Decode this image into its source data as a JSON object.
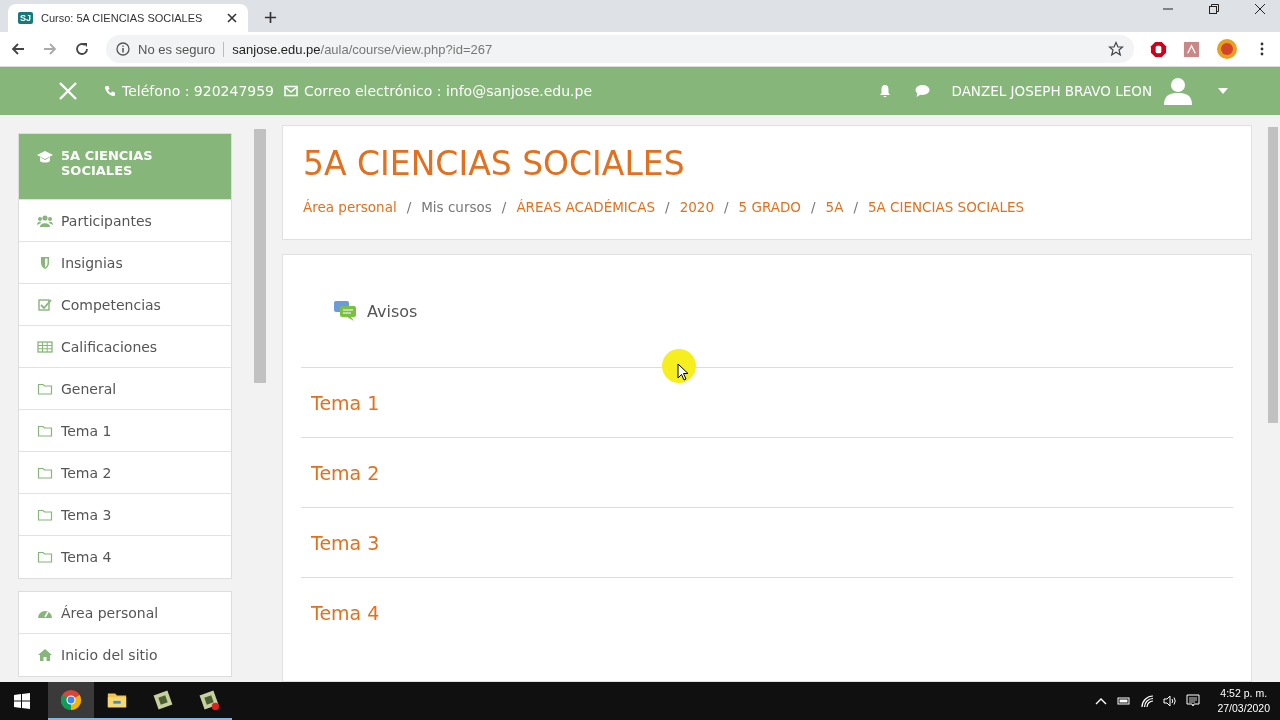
{
  "browser": {
    "tab_title": "Curso: 5A CIENCIAS SOCIALES",
    "tab_badge": "SJ",
    "security": "No es seguro",
    "url_host": "sanjose.edu.pe",
    "url_path": "/aula/course/view.php?id=267"
  },
  "header": {
    "phone": "Teléfono : 920247959",
    "email": "Correo electrónico : info@sanjose.edu.pe",
    "user_name": "DANZEL JOSEPH BRAVO LEON"
  },
  "sidebar": {
    "groups": [
      [
        {
          "label": "5A CIENCIAS SOCIALES",
          "selected": true
        },
        {
          "label": "Participantes",
          "selected": false
        },
        {
          "label": "Insignias",
          "selected": false
        },
        {
          "label": "Competencias",
          "selected": false
        },
        {
          "label": "Calificaciones",
          "selected": false
        },
        {
          "label": "General",
          "selected": false
        },
        {
          "label": "Tema 1",
          "selected": false
        },
        {
          "label": "Tema 2",
          "selected": false
        },
        {
          "label": "Tema 3",
          "selected": false
        },
        {
          "label": "Tema 4",
          "selected": false
        }
      ],
      [
        {
          "label": "Área personal",
          "selected": false
        },
        {
          "label": "Inicio del sitio",
          "selected": false
        }
      ]
    ]
  },
  "course": {
    "title": "5A CIENCIAS SOCIALES",
    "breadcrumb": [
      {
        "kind": "link",
        "label": "Área personal"
      },
      {
        "kind": "separator",
        "label": "/"
      },
      {
        "kind": "text",
        "label": "Mis cursos"
      },
      {
        "kind": "separator",
        "label": "/"
      },
      {
        "kind": "link",
        "label": "ÁREAS ACADÉMICAS"
      },
      {
        "kind": "separator",
        "label": "/"
      },
      {
        "kind": "link",
        "label": "2020"
      },
      {
        "kind": "separator",
        "label": "/"
      },
      {
        "kind": "link",
        "label": "5 GRADO"
      },
      {
        "kind": "separator",
        "label": "/"
      },
      {
        "kind": "link",
        "label": "5A"
      },
      {
        "kind": "separator",
        "label": "/"
      },
      {
        "kind": "link",
        "label": "5A CIENCIAS SOCIALES"
      }
    ]
  },
  "content": {
    "announcement": "Avisos",
    "sections": [
      "Tema 1",
      "Tema 2",
      "Tema 3",
      "Tema 4"
    ]
  },
  "taskbar": {
    "apps": [
      {
        "active": true
      },
      {
        "active": false
      },
      {
        "active": false
      },
      {
        "active": false
      }
    ],
    "time": "4:52 p. m.",
    "date": "27/03/2020"
  }
}
